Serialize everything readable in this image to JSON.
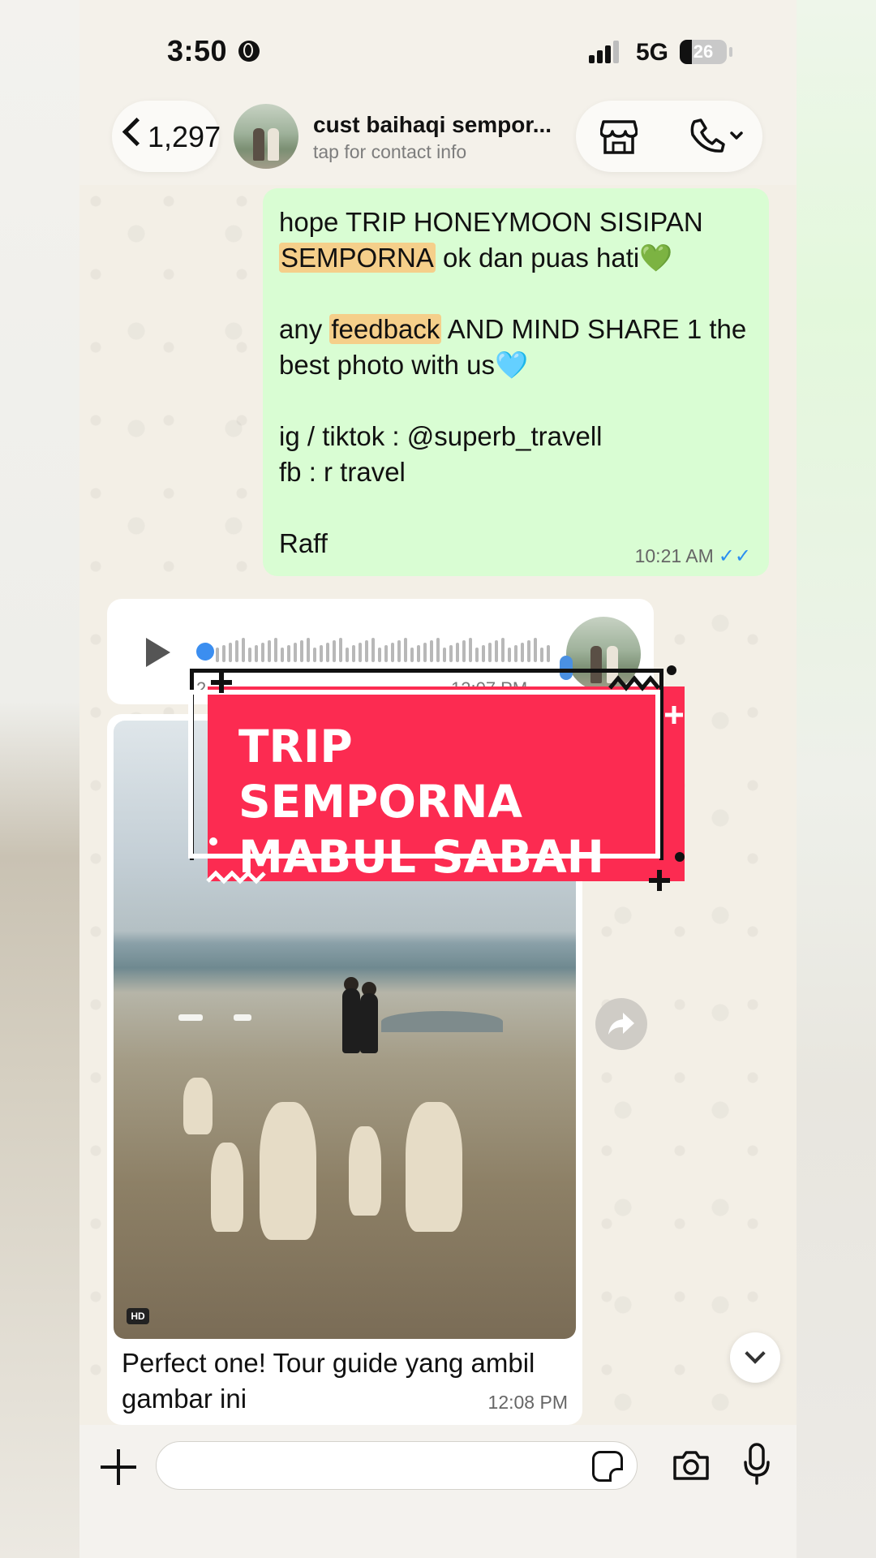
{
  "status_bar": {
    "time": "3:50",
    "network": "5G",
    "battery": "26",
    "battery_level": 0.26
  },
  "header": {
    "back_count": "1,297",
    "contact_name": "cust baihaqi sempor...",
    "contact_subtitle": "tap for contact info",
    "icons": [
      "chevron-left-icon",
      "store-icon",
      "phone-icon",
      "chevron-down-icon"
    ]
  },
  "messages": {
    "outgoing": {
      "line1": "hope TRIP HONEYMOON SISIPAN",
      "highlight1": "SEMPORNA",
      "line2_rest": " ok dan puas hati",
      "emoji1": "💚",
      "line3_pre": "any ",
      "highlight2": "feedback",
      "line3_rest": " AND MIND SHARE 1 the best photo with us",
      "emoji2": "🩵",
      "line4": "ig / tiktok : @superb_travell",
      "line5": "fb : r travel",
      "line6": "Raff",
      "time": "10:21 AM",
      "ticks": "✓✓"
    },
    "voice": {
      "duration": "2",
      "time": "12:07 PM"
    },
    "photo": {
      "badge": "HD",
      "caption": "Perfect one! Tour guide yang ambil gambar ini",
      "time": "12:08 PM"
    }
  },
  "overlay": {
    "line1": "TRIP SEMPORNA",
    "line2": "MABUL SABAH"
  },
  "input_bar": {
    "placeholder": ""
  },
  "colors": {
    "bubble_out": "#d9fdd3",
    "banner": "#fc2b51",
    "tick_blue": "#2a8ef0",
    "highlight": "#f5cf8a"
  }
}
